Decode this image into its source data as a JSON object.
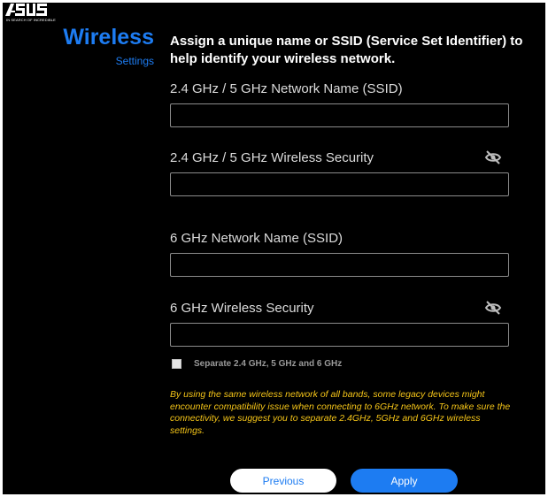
{
  "brand": {
    "logo_text": "ASUS",
    "tagline": "IN SEARCH OF INCREDIBLE"
  },
  "sidebar": {
    "title": "Wireless",
    "subtitle": "Settings"
  },
  "main": {
    "headline": "Assign a unique name or SSID (Service Set Identifier) to help identify your wireless network.",
    "fields": [
      {
        "label": "2.4 GHz / 5 GHz Network Name (SSID)",
        "value": "",
        "icon": null
      },
      {
        "label": "2.4 GHz / 5 GHz Wireless Security",
        "value": "",
        "icon": "eye-slash-icon"
      },
      {
        "label": "6 GHz Network Name (SSID)",
        "value": "",
        "icon": null
      },
      {
        "label": "6 GHz Wireless Security",
        "value": "",
        "icon": "eye-slash-icon"
      }
    ],
    "separate_checkbox": {
      "label": "Separate 2.4 GHz, 5 GHz and 6 GHz",
      "checked": false
    },
    "notice": "By using the same wireless network of all bands, some legacy devices might encounter compatibility issue when connecting to 6GHz network. To make sure the connectivity, we suggest you to separate 2.4GHz, 5GHz and 6GHz wireless settings."
  },
  "buttons": {
    "previous": "Previous",
    "apply": "Apply"
  },
  "colors": {
    "background": "#000000",
    "accent": "#1d7cf2",
    "notice": "#f5c518",
    "text": "#dcdcdc"
  }
}
